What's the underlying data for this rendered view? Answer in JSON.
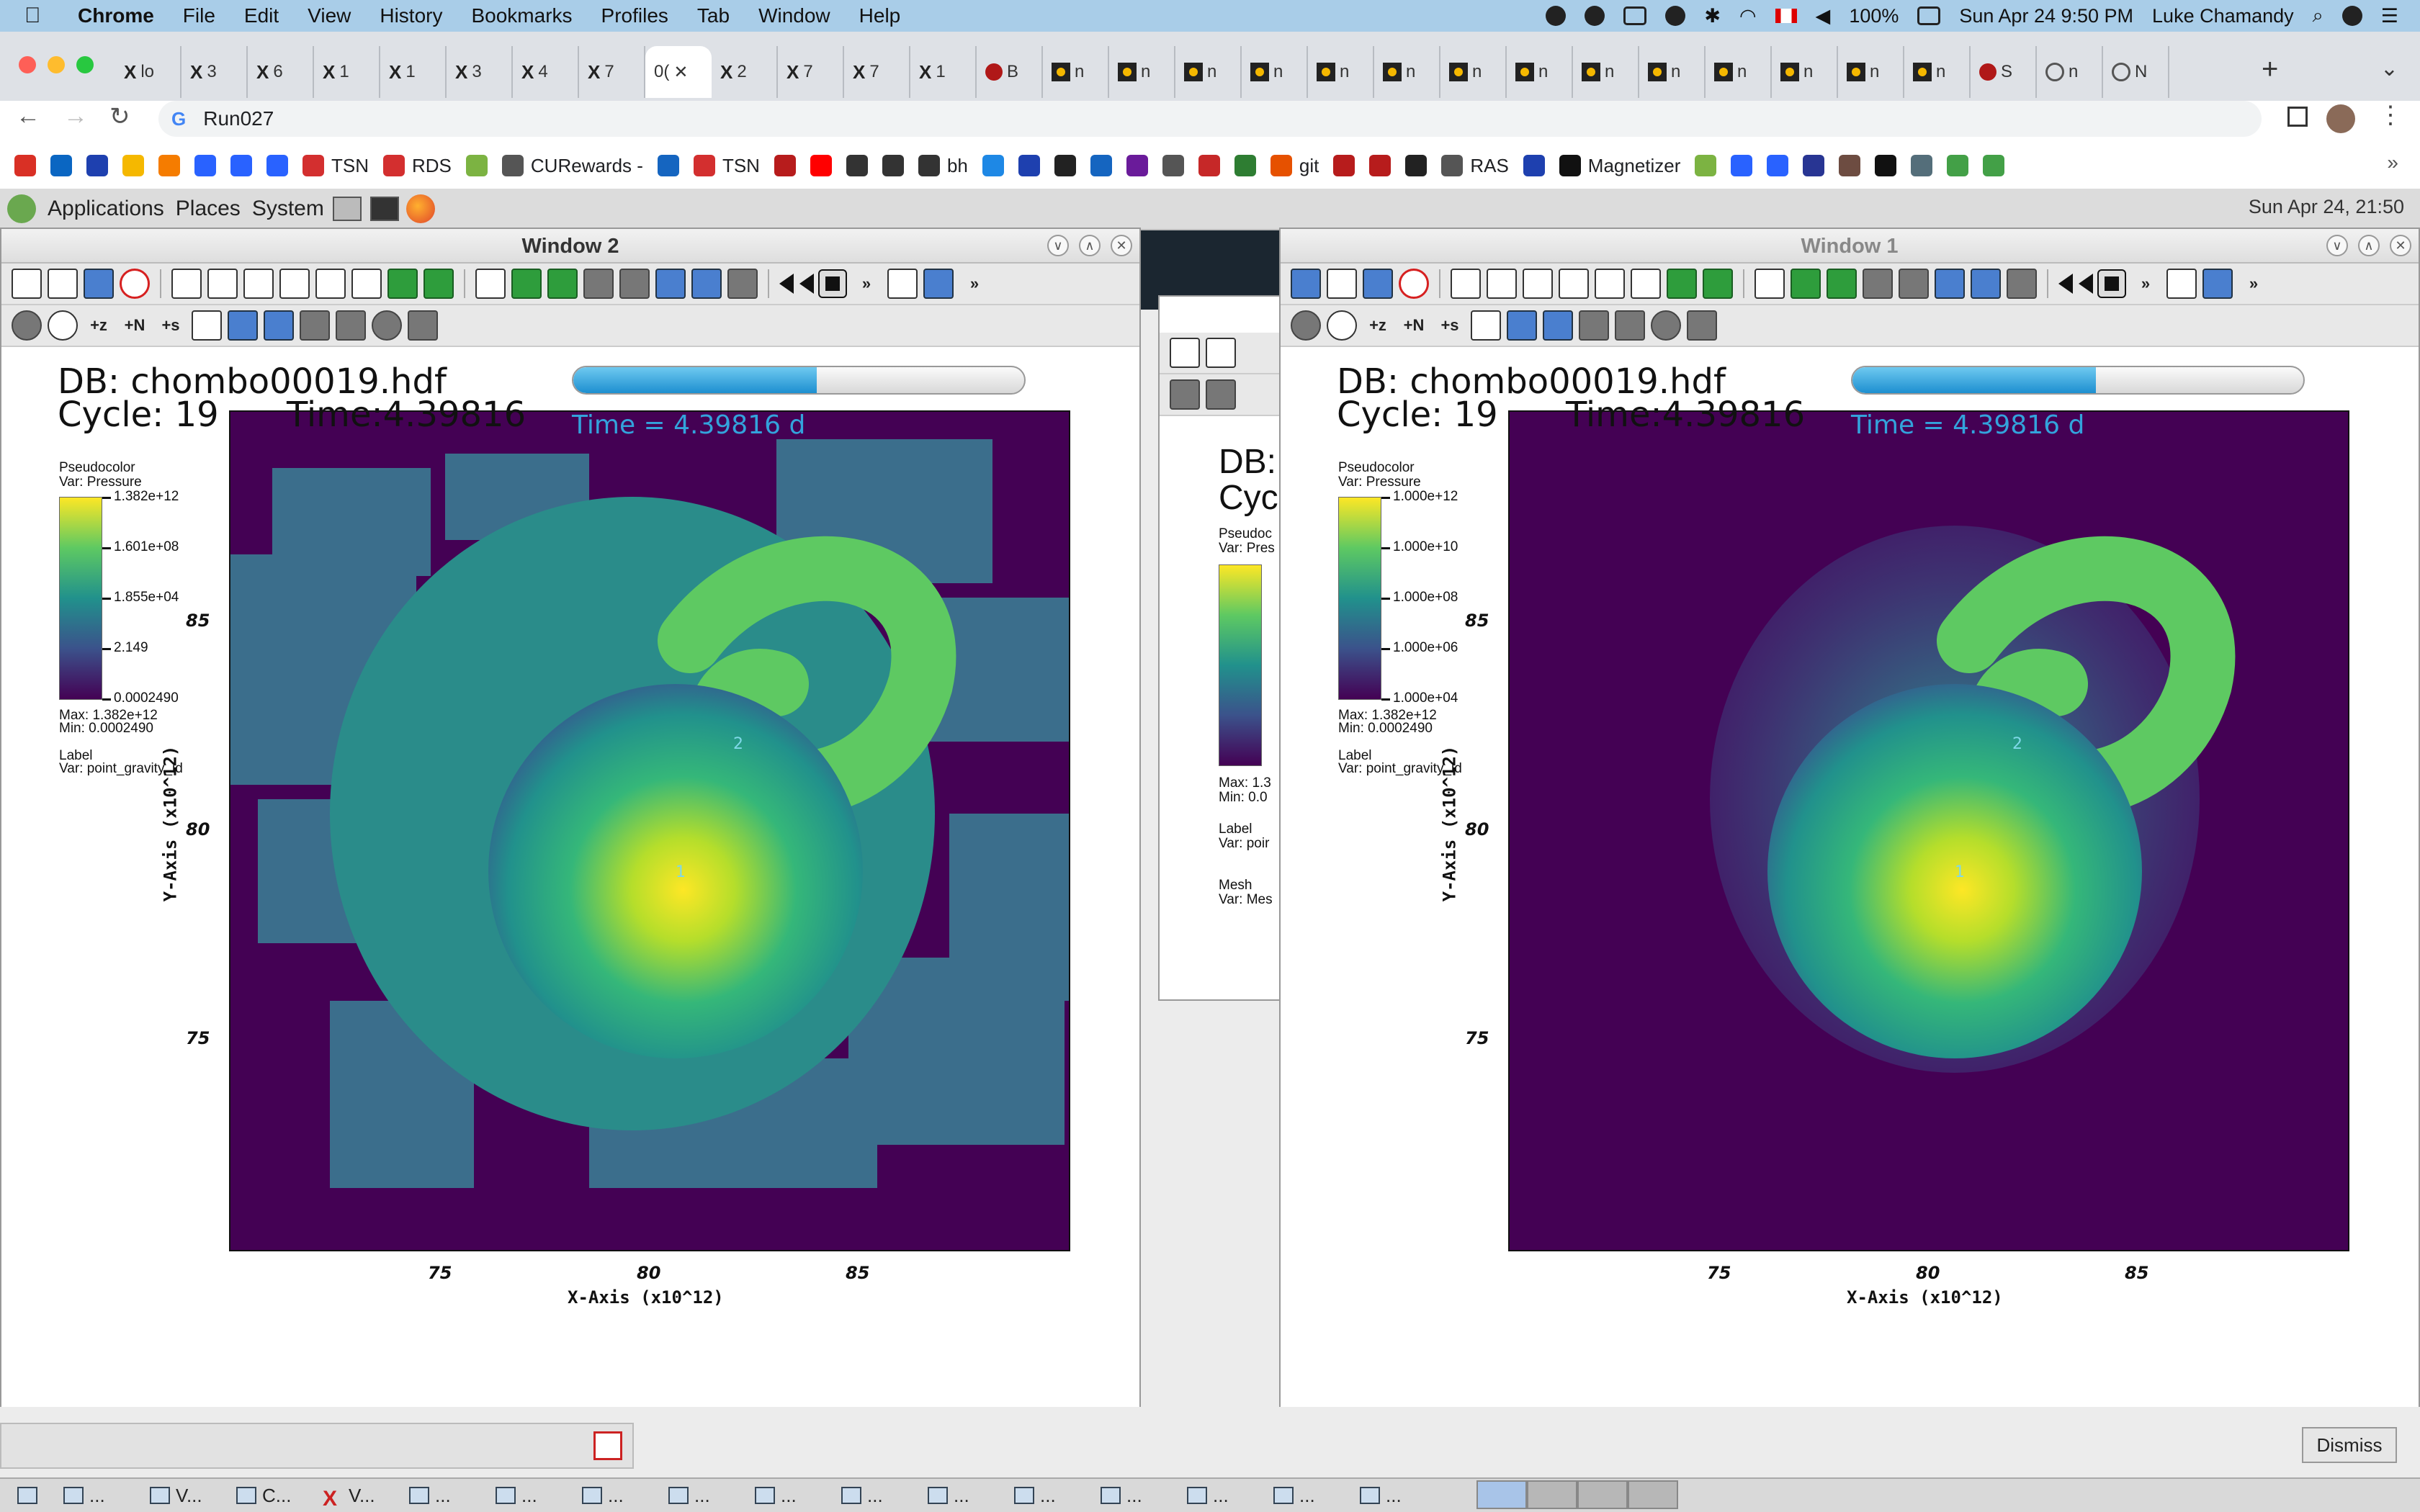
{
  "mac_menu": {
    "app": "Chrome",
    "items": [
      "File",
      "Edit",
      "View",
      "History",
      "Bookmarks",
      "Profiles",
      "Tab",
      "Window",
      "Help"
    ],
    "battery": "100%",
    "datetime": "Sun Apr 24  9:50 PM",
    "user": "Luke Chamandy"
  },
  "chrome": {
    "tabs": [
      {
        "icon": "X",
        "label": "lo"
      },
      {
        "icon": "X",
        "label": "3"
      },
      {
        "icon": "X",
        "label": "6"
      },
      {
        "icon": "X",
        "label": "1"
      },
      {
        "icon": "X",
        "label": "1"
      },
      {
        "icon": "X",
        "label": "3"
      },
      {
        "icon": "X",
        "label": "4"
      },
      {
        "icon": "X",
        "label": "7"
      },
      {
        "icon": "",
        "label": "0("
      },
      {
        "icon": "X",
        "label": "2"
      },
      {
        "icon": "X",
        "label": "7"
      },
      {
        "icon": "X",
        "label": "7"
      },
      {
        "icon": "X",
        "label": "1"
      },
      {
        "icon": "paw",
        "label": "B"
      },
      {
        "icon": "sun",
        "label": "n"
      },
      {
        "icon": "sun",
        "label": "n"
      },
      {
        "icon": "sun",
        "label": "n"
      },
      {
        "icon": "sun",
        "label": "n"
      },
      {
        "icon": "sun",
        "label": "n"
      },
      {
        "icon": "sun",
        "label": "n"
      },
      {
        "icon": "sun",
        "label": "n"
      },
      {
        "icon": "sun",
        "label": "n"
      },
      {
        "icon": "sun",
        "label": "n"
      },
      {
        "icon": "sun",
        "label": "n"
      },
      {
        "icon": "sun",
        "label": "n"
      },
      {
        "icon": "sun",
        "label": "n"
      },
      {
        "icon": "sun",
        "label": "n"
      },
      {
        "icon": "sun",
        "label": "n"
      },
      {
        "icon": "paw",
        "label": "S"
      },
      {
        "icon": "globe",
        "label": "n"
      },
      {
        "icon": "globe",
        "label": "N"
      }
    ],
    "active_tab_index": 8,
    "url": "Run027",
    "bookmarks": [
      {
        "label": "",
        "color": "#d93025"
      },
      {
        "label": "",
        "color": "#0a66c2"
      },
      {
        "label": "",
        "color": "#1e40af"
      },
      {
        "label": "",
        "color": "#f5b800"
      },
      {
        "label": "",
        "color": "#f57c00"
      },
      {
        "label": "",
        "color": "#2962ff"
      },
      {
        "label": "",
        "color": "#2962ff"
      },
      {
        "label": "",
        "color": "#2962ff"
      },
      {
        "label": "TSN",
        "color": "#d32f2f"
      },
      {
        "label": "RDS",
        "color": "#d32f2f"
      },
      {
        "label": "",
        "color": "#7cb342"
      },
      {
        "label": "CURewards -",
        "color": "#555555"
      },
      {
        "label": "",
        "color": "#1565c0"
      },
      {
        "label": "TSN",
        "color": "#d32f2f"
      },
      {
        "label": "",
        "color": "#b71c1c"
      },
      {
        "label": "",
        "color": "#ff0000"
      },
      {
        "label": "",
        "color": "#333333"
      },
      {
        "label": "",
        "color": "#333333"
      },
      {
        "label": "bh",
        "color": "#333333"
      },
      {
        "label": "",
        "color": "#1e88e5"
      },
      {
        "label": "",
        "color": "#1e40af"
      },
      {
        "label": "",
        "color": "#222222"
      },
      {
        "label": "",
        "color": "#1565c0"
      },
      {
        "label": "",
        "color": "#6a1b9a"
      },
      {
        "label": "",
        "color": "#555555"
      },
      {
        "label": "",
        "color": "#c62828"
      },
      {
        "label": "",
        "color": "#2e7d32"
      },
      {
        "label": "git",
        "color": "#e65100"
      },
      {
        "label": "",
        "color": "#b71c1c"
      },
      {
        "label": "",
        "color": "#b71c1c"
      },
      {
        "label": "",
        "color": "#222222"
      },
      {
        "label": "RAS",
        "color": "#555555"
      },
      {
        "label": "",
        "color": "#1e40af"
      },
      {
        "label": "Magnetizer",
        "color": "#111111"
      },
      {
        "label": "",
        "color": "#7cb342"
      },
      {
        "label": "",
        "color": "#2962ff"
      },
      {
        "label": "",
        "color": "#2962ff"
      },
      {
        "label": "",
        "color": "#283593"
      },
      {
        "label": "",
        "color": "#6d4c41"
      },
      {
        "label": "",
        "color": "#111111"
      },
      {
        "label": "",
        "color": "#546e7a"
      },
      {
        "label": "",
        "color": "#43a047"
      },
      {
        "label": "",
        "color": "#43a047"
      }
    ]
  },
  "gnome": {
    "menus": [
      "Applications",
      "Places",
      "System"
    ],
    "clock": "Sun Apr 24, 21:50"
  },
  "window2": {
    "title": "Window 2",
    "db": "DB: chombo00019.hdf",
    "cycle": "Cycle: 19",
    "time": "Time:4.39816",
    "time_annotation": "Time = 4.39816 d",
    "progress": 0.54,
    "legend": {
      "type": "Pseudocolor",
      "var": "Var: Pressure",
      "ticks": [
        "1.382e+12",
        "1.601e+08",
        "1.855e+04",
        "2.149",
        "0.0002490"
      ],
      "max": "Max:  1.382e+12",
      "min": "Min:  0.0002490",
      "label_type": "Label",
      "label_var": "Var: point_gravity_id"
    },
    "xticks": [
      "75",
      "80",
      "85"
    ],
    "yticks": [
      "85",
      "80",
      "75"
    ],
    "xlabel": "X-Axis (x10^12)",
    "ylabel": "Y-Axis (x10^12)",
    "point_labels": [
      "1",
      "2"
    ]
  },
  "window1": {
    "title": "Window 1",
    "db": "DB: chombo00019.hdf",
    "cycle": "Cycle: 19",
    "time": "Time:4.39816",
    "time_annotation": "Time = 4.39816 d",
    "progress": 0.54,
    "legend": {
      "type": "Pseudocolor",
      "var": "Var: Pressure",
      "ticks": [
        "1.000e+12",
        "1.000e+10",
        "1.000e+08",
        "1.000e+06",
        "1.000e+04"
      ],
      "max": "Max:  1.382e+12",
      "min": "Min:  0.0002490",
      "label_type": "Label",
      "label_var": "Var: point_gravity_id"
    },
    "xticks": [
      "75",
      "80",
      "85"
    ],
    "yticks": [
      "85",
      "80",
      "75"
    ],
    "xlabel": "X-Axis (x10^12)",
    "ylabel": "Y-Axis (x10^12)",
    "point_labels": [
      "1",
      "2"
    ]
  },
  "hidden_window": {
    "db": "DB:",
    "cycle": "Cyc",
    "legend_type": "Pseudoc",
    "legend_var": "Var: Pres",
    "max": "Max:  1.3",
    "min": "Min:  0.0",
    "label_type": "Label",
    "label_var": "Var: poir",
    "mesh_type": "Mesh",
    "mesh_var": "Var: Mes"
  },
  "dismiss_label": "Dismiss",
  "taskbar": [
    {
      "icon": "window",
      "label": "..."
    },
    {
      "icon": "window",
      "label": "V..."
    },
    {
      "icon": "window",
      "label": "C..."
    },
    {
      "icon": "x",
      "label": "V..."
    },
    {
      "icon": "window",
      "label": "..."
    },
    {
      "icon": "window",
      "label": "..."
    },
    {
      "icon": "window",
      "label": "..."
    },
    {
      "icon": "window",
      "label": "..."
    },
    {
      "icon": "window",
      "label": "..."
    },
    {
      "icon": "window",
      "label": "..."
    },
    {
      "icon": "window",
      "label": "..."
    },
    {
      "icon": "window",
      "label": "..."
    },
    {
      "icon": "window",
      "label": "..."
    },
    {
      "icon": "window",
      "label": "..."
    },
    {
      "icon": "window",
      "label": "..."
    },
    {
      "icon": "window",
      "label": "..."
    }
  ],
  "colors": {
    "viridis_low": "#440154",
    "viridis_mid": "#21918c",
    "viridis_high": "#fde725",
    "annotation_blue": "#33a3dc"
  }
}
